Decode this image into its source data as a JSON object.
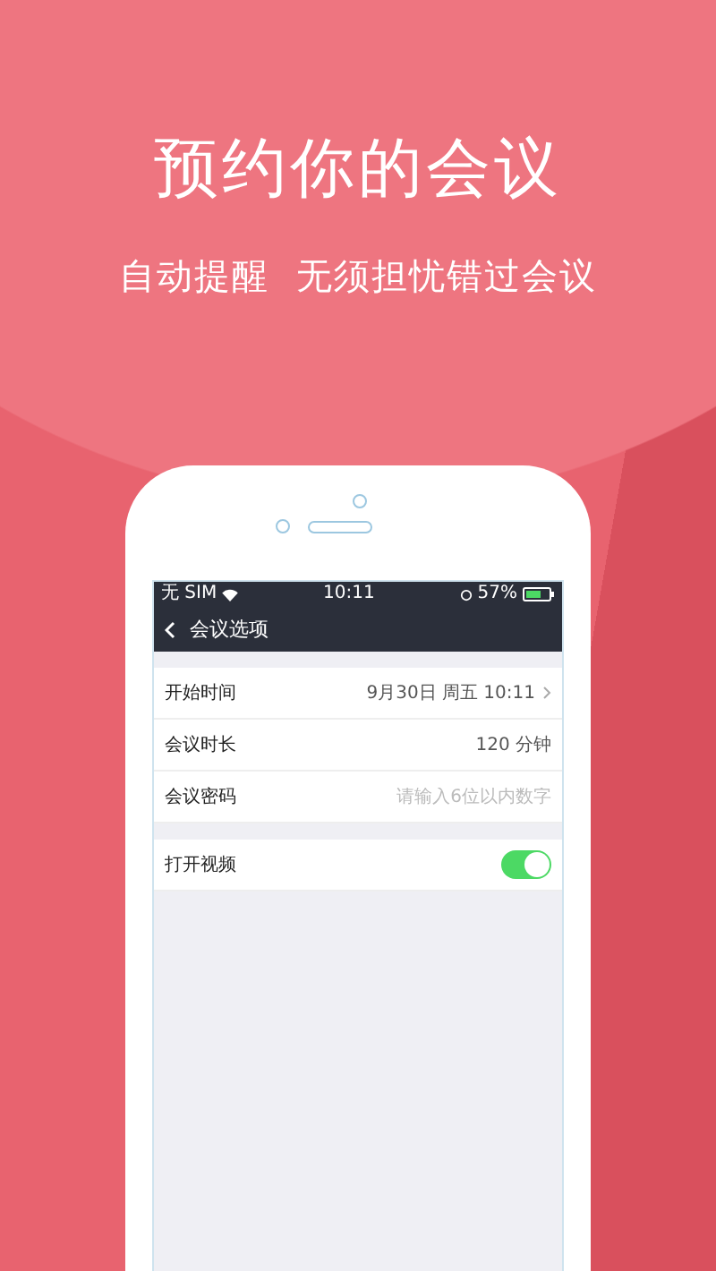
{
  "headline": "预约你的会议",
  "subtitle": "自动提醒  无须担忧错过会议",
  "status_bar": {
    "carrier": "无 SIM",
    "time": "10:11",
    "battery": "57%"
  },
  "nav": {
    "title": "会议选项"
  },
  "rows": [
    {
      "kind": "value",
      "label": "开始时间",
      "value": "9月30日 周五 10:11",
      "chevron": true
    },
    {
      "kind": "value",
      "label": "会议时长",
      "value": "120 分钟"
    },
    {
      "kind": "input",
      "label": "会议密码",
      "placeholder": "请输入6位以内数字"
    },
    {
      "kind": "toggle",
      "label": "打开视频",
      "on": true
    }
  ]
}
